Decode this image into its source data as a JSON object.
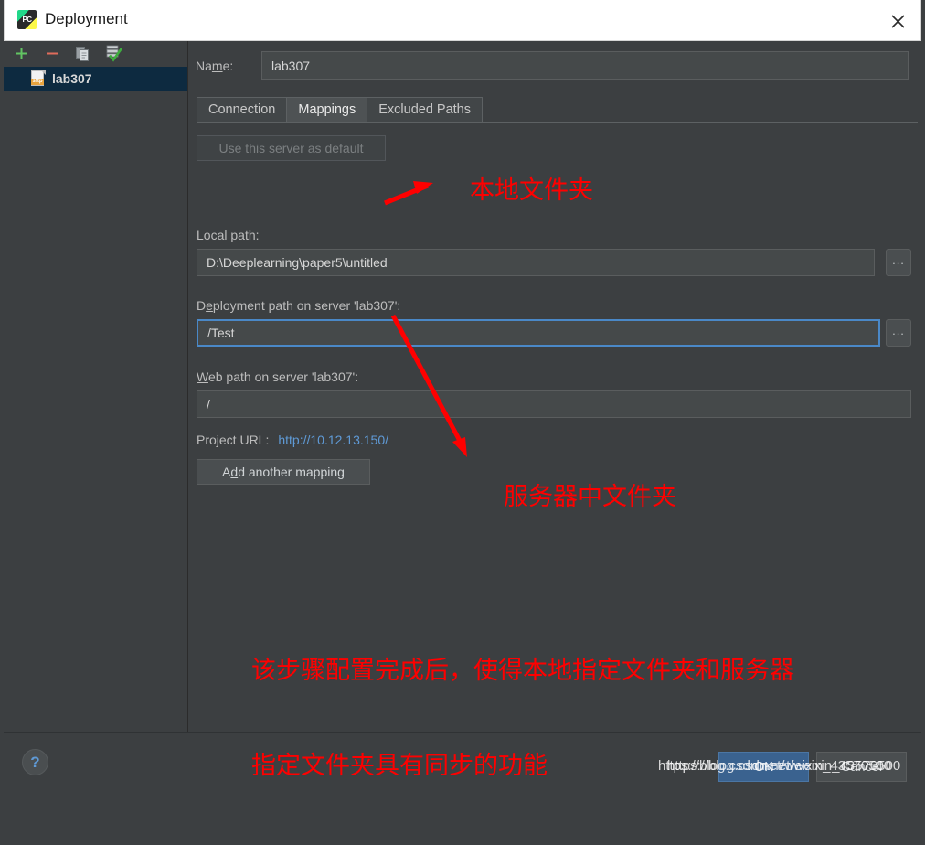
{
  "window": {
    "title": "Deployment",
    "app_icon": "pycharm-icon",
    "close_icon": "close-icon"
  },
  "sidebar": {
    "toolbar": [
      {
        "name": "add-server-button",
        "icon": "plus-icon",
        "label": "+"
      },
      {
        "name": "remove-server-button",
        "icon": "minus-icon",
        "label": "−"
      },
      {
        "name": "copy-server-button",
        "icon": "copy-icon",
        "label": ""
      },
      {
        "name": "set-default-server-button",
        "icon": "checkmark-server-icon",
        "label": ""
      }
    ],
    "servers": [
      {
        "label": "lab307",
        "icon": "sftp-file-icon",
        "selected": true
      }
    ]
  },
  "form": {
    "name_label": "Na",
    "name_label_mnemonic": "m",
    "name_label_rest": "e:",
    "name_value": "lab307",
    "name_placeholder": ""
  },
  "tabs": [
    {
      "label": "Connection",
      "active": false
    },
    {
      "label": "Mappings",
      "active": true
    },
    {
      "label": "Excluded Paths",
      "active": false
    }
  ],
  "mappings": {
    "use_default_button": "Use this server as default",
    "local_path": {
      "label_mnemonic": "L",
      "label_rest": "ocal path:",
      "value": "D:\\Deeplearning\\paper5\\untitled",
      "browse_label": "..."
    },
    "deployment_path": {
      "label_prefix": "D",
      "label_mnemonic": "e",
      "label_rest": "ployment path on server 'lab307':",
      "value": "/Test",
      "browse_label": "...",
      "focused": true
    },
    "web_path": {
      "label_mnemonic": "W",
      "label_rest": "eb path on server 'lab307':",
      "value": "/"
    },
    "project_url_label": "Project URL:",
    "project_url_value": "http://10.12.13.150/",
    "add_mapping_prefix": "A",
    "add_mapping_mnemonic": "d",
    "add_mapping_rest": "d another mapping"
  },
  "annotations": {
    "local_folder": "本地文件夹",
    "server_folder": "服务器中文件夹",
    "summary_line1": "该步骤配置完成后，使得本地指定文件夹和服务器",
    "summary_line2": "指定文件夹具有同步的功能",
    "color": "#ff0000"
  },
  "footer": {
    "help_label": "?",
    "ok_label": "OK",
    "cancel_label": "Cancel"
  },
  "watermark": {
    "text": "https://blog.csdn.net/weixin_43570500"
  },
  "colors": {
    "panel_bg": "#3c3f41",
    "titlebar_bg": "#ffffff",
    "selected_row": "#0d2a40",
    "accent_link": "#5f9ad6",
    "ok_button": "#3a628f",
    "focus_border": "#4a88c7",
    "annotation_red": "#ff0000"
  }
}
